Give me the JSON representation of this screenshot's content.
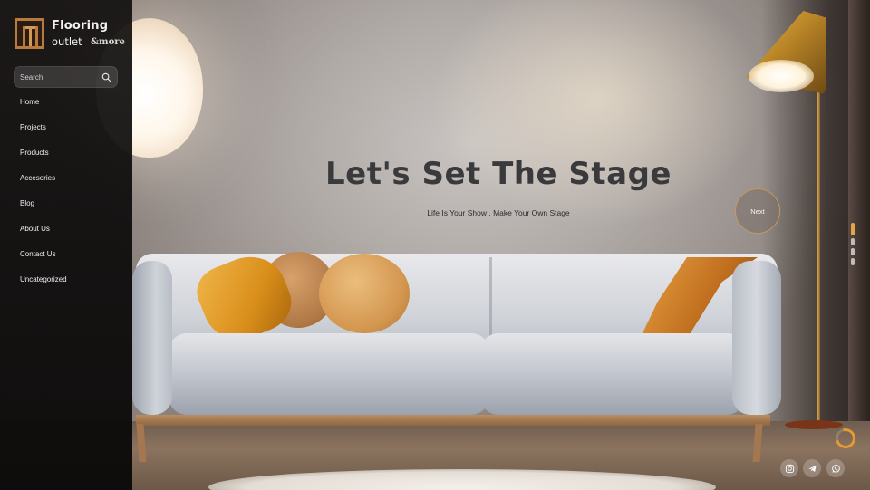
{
  "brand": {
    "name_line1": "Flooring",
    "name_line2": "outlet",
    "name_suffix": "&more",
    "accent_color": "#b87a3d"
  },
  "search": {
    "placeholder": "Search",
    "icon": "search-icon"
  },
  "nav": {
    "items": [
      {
        "label": "Home"
      },
      {
        "label": "Projects"
      },
      {
        "label": "Products"
      },
      {
        "label": "Accesories"
      },
      {
        "label": "Blog"
      },
      {
        "label": "About Us"
      },
      {
        "label": "Contact Us"
      },
      {
        "label": "Uncategorized"
      }
    ]
  },
  "hero": {
    "title": "Let's Set The Stage",
    "subtitle": "Life Is Your Show , Make Your Own Stage",
    "next_label": "Next",
    "slide_count": 4,
    "active_slide": 1
  },
  "social": {
    "icons": [
      "instagram-icon",
      "telegram-icon",
      "whatsapp-icon"
    ]
  },
  "colors": {
    "loader": "#e59a32",
    "next_border": "#c49a58",
    "active_dot": "#e2a649"
  }
}
